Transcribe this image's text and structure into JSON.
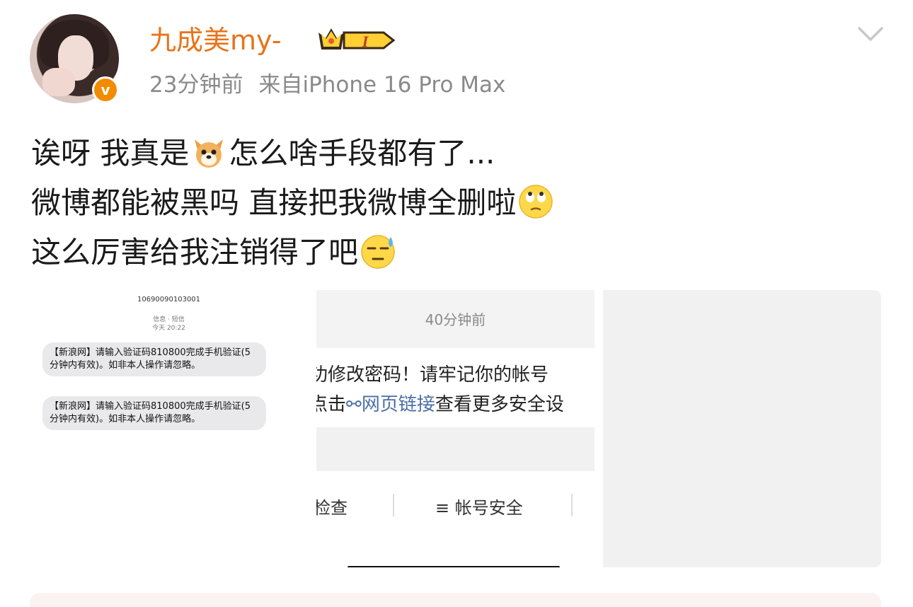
{
  "post": {
    "username": "九成美my-",
    "vip_level": "I",
    "time_ago": "23分钟前",
    "source": "来自iPhone 16 Pro Max",
    "lines": [
      {
        "before": "诶呀 我真是",
        "emoji": "dog-face",
        "after": "怎么啥手段都有了..."
      },
      {
        "before": "微博都能被黑吗 直接把我微博全删啦",
        "emoji": "eye-roll-face",
        "after": ""
      },
      {
        "before": "这么厉害给我注销得了吧",
        "emoji": "sweat-face",
        "after": ""
      }
    ]
  },
  "images": {
    "sms": {
      "number": "10690090103001",
      "header_label": "信息 · 短信",
      "header_time": "今天 20:22",
      "messages": [
        "【新浪网】请输入验证码810800完成手机验证(5分钟内有效)。如非本人操作请忽略。",
        "【新浪网】请输入验证码810800完成手机验证(5分钟内有效)。如非本人操作请忽略。"
      ]
    },
    "notice": {
      "time": "40分钟前",
      "line1": "功修改密码！请牢记你的帐号",
      "line2_before": "点击",
      "link_text": "网页链接",
      "line2_after": "查看更多安全设",
      "tab_left": "检查",
      "tab_right": "≡ 帐号安全"
    }
  },
  "colors": {
    "username": "#e8731a",
    "meta": "#8a8a8a",
    "verified_badge": "#f28b00",
    "link": "#4a6fa5"
  }
}
